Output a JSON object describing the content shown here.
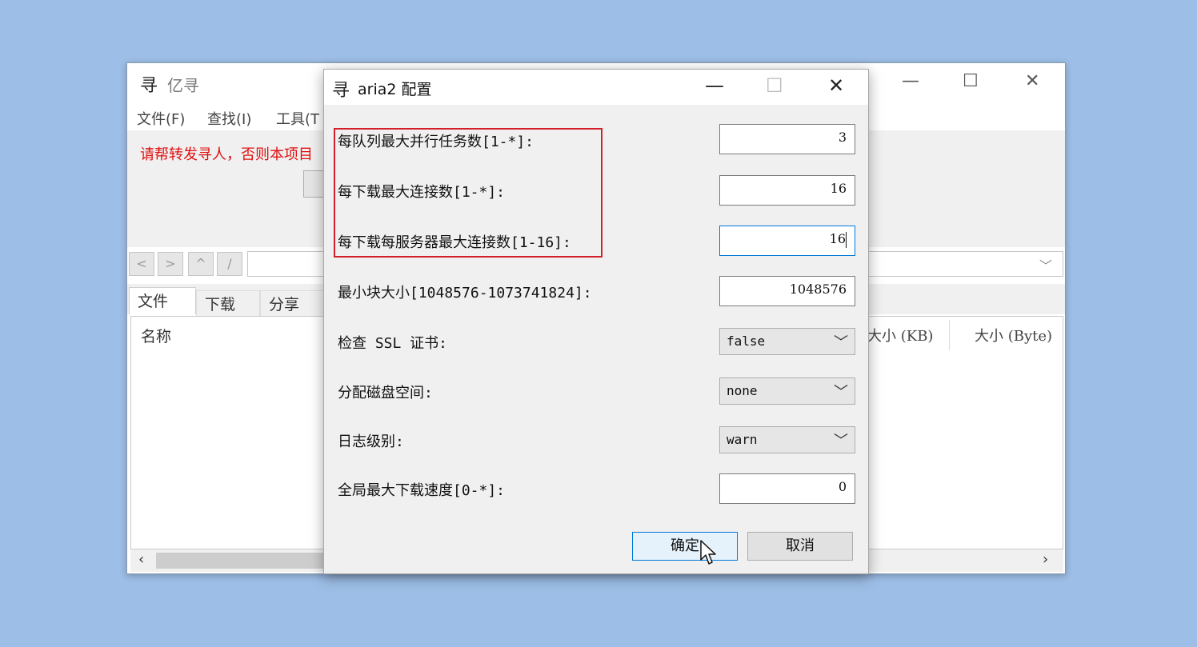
{
  "main_window": {
    "logo": "寻",
    "title": "亿寻",
    "menu": [
      "文件(F)",
      "查找(I)",
      "工具(T"
    ],
    "notice": "请帮转发寻人，否则本项目",
    "nav_buttons": [
      "<",
      ">",
      "^",
      "/"
    ],
    "tabs": [
      "文件",
      "下载",
      "分享"
    ],
    "columns": {
      "name": "名称",
      "size_kb": "大小 (KB)",
      "size_byte": "大小 (Byte)"
    },
    "controls": {
      "minimize": "—",
      "maximize": "☐",
      "close": "✕"
    }
  },
  "dialog": {
    "logo": "寻",
    "title": "aria2 配置",
    "controls": {
      "minimize": "—",
      "maximize": "☐",
      "close": "✕"
    },
    "fields": [
      {
        "label": "每队列最大并行任务数[1-*]:",
        "value": "3"
      },
      {
        "label": "每下载最大连接数[1-*]:",
        "value": "16"
      },
      {
        "label": "每下载每服务器最大连接数[1-16]:",
        "value": "16"
      },
      {
        "label": "最小块大小[1048576-1073741824]:",
        "value": "1048576"
      },
      {
        "label": "检查 SSL 证书:",
        "value": "false"
      },
      {
        "label": "分配磁盘空间:",
        "value": "none"
      },
      {
        "label": "日志级别:",
        "value": "warn"
      },
      {
        "label": "全局最大下载速度[0-*]:",
        "value": "0"
      }
    ],
    "ok_label": "确定",
    "cancel_label": "取消"
  },
  "colors": {
    "desktop": "#9dbee6",
    "highlight": "#d21f2a",
    "notice": "#e01010",
    "focus": "#0078d7"
  }
}
